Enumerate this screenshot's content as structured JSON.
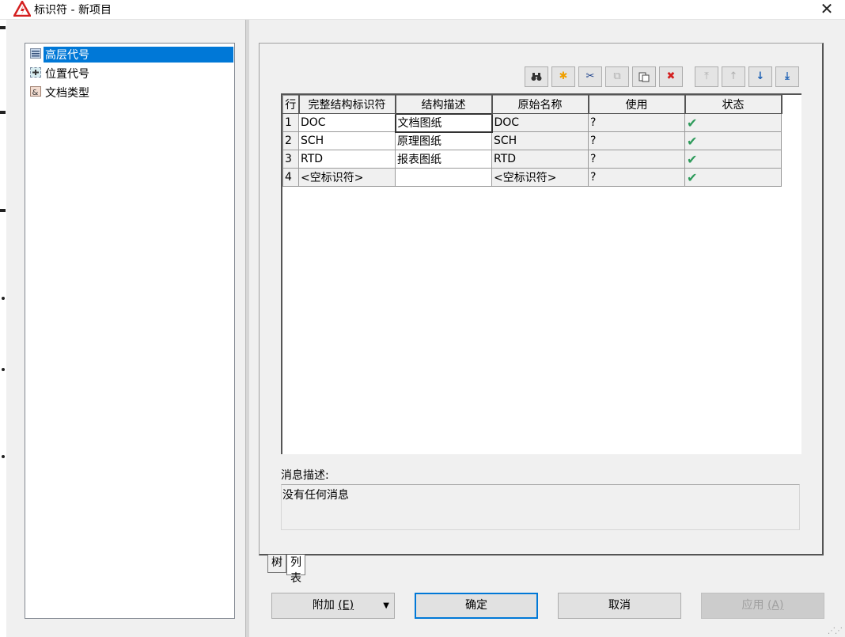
{
  "window": {
    "title": "标识符 - 新项目",
    "close_glyph": "✕"
  },
  "tree": {
    "items": [
      {
        "label": "高层代号",
        "icon": "list-icon",
        "selected": true
      },
      {
        "label": "位置代号",
        "icon": "plus-box-icon",
        "selected": false
      },
      {
        "label": "文档类型",
        "icon": "ampersand-icon",
        "selected": false
      }
    ]
  },
  "toolbar": {
    "buttons": [
      {
        "name": "find-button",
        "glyph": "🔍",
        "disabled": false
      },
      {
        "name": "new-button",
        "glyph": "✱",
        "disabled": false,
        "color": "#f0a000"
      },
      {
        "name": "cut-button",
        "glyph": "✂",
        "disabled": false
      },
      {
        "name": "copy-button",
        "glyph": "⧉",
        "disabled": true
      },
      {
        "name": "paste-button",
        "glyph": "📋",
        "disabled": false
      },
      {
        "name": "delete-button",
        "glyph": "✖",
        "disabled": false,
        "color": "#d42020"
      },
      {
        "name": "move-top-button",
        "glyph": "⤒",
        "disabled": true
      },
      {
        "name": "move-up-button",
        "glyph": "↑",
        "disabled": true
      },
      {
        "name": "move-down-button",
        "glyph": "↓",
        "disabled": false,
        "color": "#1a5fb4"
      },
      {
        "name": "move-bottom-button",
        "glyph": "⤓",
        "disabled": false,
        "color": "#1a5fb4"
      }
    ]
  },
  "grid": {
    "columns": [
      "行",
      "完整结构标识符",
      "结构描述",
      "原始名称",
      "使用",
      "状态"
    ],
    "rows": [
      {
        "row": "1",
        "id": "DOC",
        "desc": "文档图纸",
        "orig": "DOC",
        "use": "?",
        "status": "✔"
      },
      {
        "row": "2",
        "id": "SCH",
        "desc": "原理图纸",
        "orig": "SCH",
        "use": "?",
        "status": "✔"
      },
      {
        "row": "3",
        "id": "RTD",
        "desc": "报表图纸",
        "orig": "RTD",
        "use": "?",
        "status": "✔"
      },
      {
        "row": "4",
        "id": "<空标识符>",
        "desc": "",
        "orig": "<空标识符>",
        "use": "?",
        "status": "✔"
      }
    ]
  },
  "message": {
    "label": "消息描述:",
    "text": "没有任何消息"
  },
  "tabs": [
    {
      "label": "树",
      "active": false
    },
    {
      "label": "列表",
      "active": true
    }
  ],
  "buttons": {
    "attach_label": "附加",
    "attach_key": "(E)",
    "ok_label": "确定",
    "cancel_label": "取消",
    "apply_label": "应用",
    "apply_key": "(A)"
  },
  "colors": {
    "selection": "#0078d7",
    "check": "#2e9b5b",
    "default_button_border": "#0078d7"
  }
}
